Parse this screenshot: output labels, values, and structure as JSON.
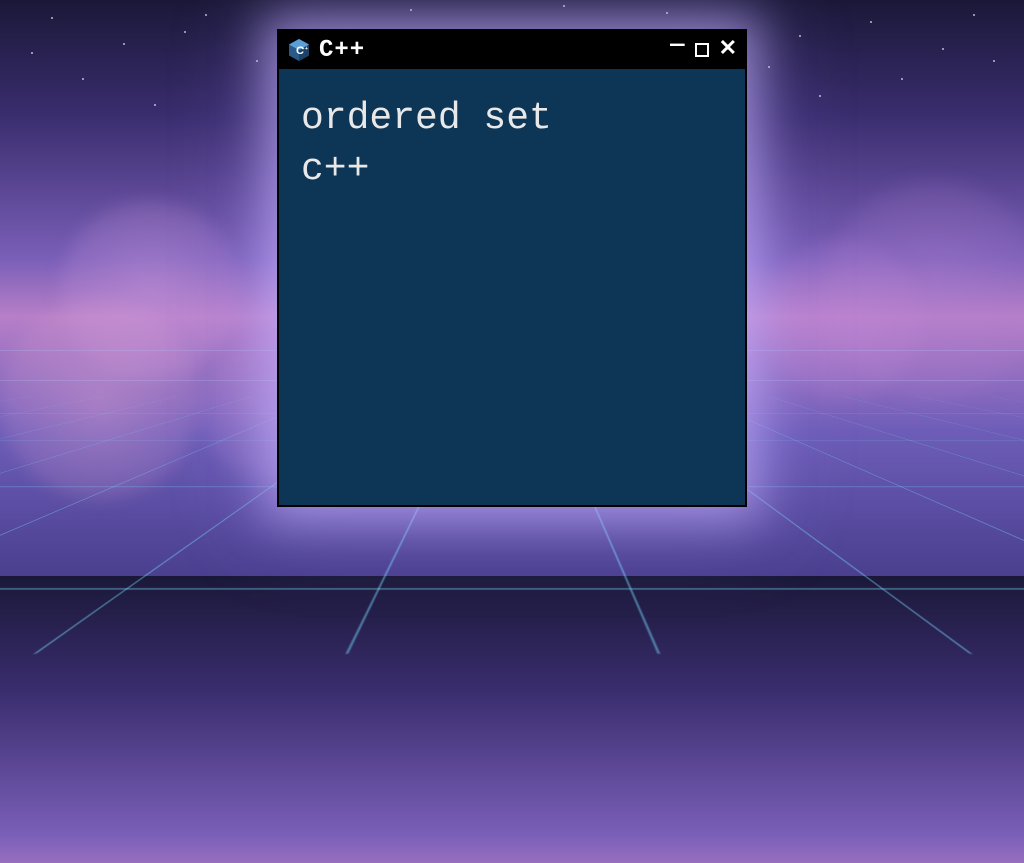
{
  "window": {
    "title": "C++",
    "icon_name": "cpp-icon"
  },
  "terminal": {
    "content": "ordered set\nc++"
  },
  "colors": {
    "terminal_bg": "#0d3556",
    "titlebar_bg": "#000000",
    "text": "#e8e8e8",
    "icon_blue": "#5c9fd6",
    "icon_dark": "#2a5a8a"
  }
}
